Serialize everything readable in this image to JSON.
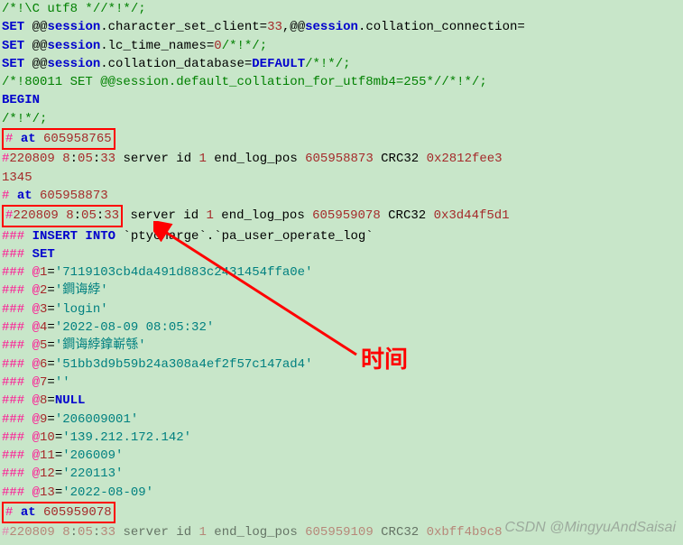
{
  "lines": {
    "l1": "/*!\\C utf8 *//*!*/;",
    "l2a": "SET",
    "l2b": " @@",
    "l2c": "session",
    "l2d": ".character_set_client=",
    "l2e": "33",
    "l2f": ",@@",
    "l2g": "session",
    "l2h": ".collation_connection=",
    "l3a": "SET",
    "l3b": " @@",
    "l3c": "session",
    "l3d": ".lc_time_names=",
    "l3e": "0",
    "l3f": "/*!*/;",
    "l4a": "SET",
    "l4b": " @@",
    "l4c": "session",
    "l4d": ".collation_database=",
    "l4e": "DEFAULT",
    "l4f": "/*!*/;",
    "l5a": "/*!80011 SET @@",
    "l5b": "session",
    "l5c": ".default_collation_for_utf8mb4=",
    "l5d": "255",
    "l5e": "*//*!*/;",
    "l6": "BEGIN",
    "l7": "/*!*/;",
    "l8a": "# ",
    "l8b": "at",
    "l8c": " 605958765",
    "l9a": "#",
    "l9b": "220809",
    "l9c": "   ",
    "l9d": "8",
    "l9e": ":",
    "l9f": "05",
    "l9g": ":",
    "l9h": "33",
    "l9i": " server id ",
    "l9j": "1",
    "l9k": "  end_log_pos ",
    "l9l": "605958873",
    "l9m": " CRC32 ",
    "l9n": "0x2812fee3",
    "l9o": "1345",
    "l10a": "# ",
    "l10b": "at",
    "l10c": " 605958873",
    "l11a": "#",
    "l11b": "220809",
    "l11c": "   ",
    "l11d": "8",
    "l11e": ":",
    "l11f": "05",
    "l11g": ":",
    "l11h": "33",
    "l11i": " server id ",
    "l11j": "1",
    "l11k": "  end_log_pos ",
    "l11l": "605959078",
    "l11m": " CRC32 ",
    "l11n": "0x3d44f5d1",
    "l12a": "### ",
    "l12b": "INSERT INTO",
    "l12c": " `ptycharge`.`pa_user_operate_log`",
    "l13a": "### ",
    "l13b": "SET",
    "l14a": "###   @",
    "l14b": "1",
    "l14c": "=",
    "l14d": "'7119103cb4da491d883c2431454ffa0e'",
    "l15a": "###   @",
    "l15b": "2",
    "l15c": "=",
    "l15d": "'鐧诲綍'",
    "l16a": "###   @",
    "l16b": "3",
    "l16c": "=",
    "l16d": "'login'",
    "l17a": "###   @",
    "l17b": "4",
    "l17c": "=",
    "l17d": "'2022-08-09 08:05:32'",
    "l18a": "###   @",
    "l18b": "5",
    "l18c": "=",
    "l18d": "'鐧诲綍鎿嶄綔'",
    "l19a": "###   @",
    "l19b": "6",
    "l19c": "=",
    "l19d": "'51bb3d9b59b24a308a4ef2f57c147ad4'",
    "l20a": "###   @",
    "l20b": "7",
    "l20c": "=",
    "l20d": "''",
    "l21a": "###   @",
    "l21b": "8",
    "l21c": "=",
    "l21d": "NULL",
    "l22a": "###   @",
    "l22b": "9",
    "l22c": "=",
    "l22d": "'206009001'",
    "l23a": "###   @",
    "l23b": "10",
    "l23c": "=",
    "l23d": "'139.212.172.142'",
    "l24a": "###   @",
    "l24b": "11",
    "l24c": "=",
    "l24d": "'206009'",
    "l25a": "###   @",
    "l25b": "12",
    "l25c": "=",
    "l25d": "'220113'",
    "l26a": "###   @",
    "l26b": "13",
    "l26c": "=",
    "l26d": "'2022-08-09'",
    "l27a": "# ",
    "l27b": "at",
    "l27c": " 605959078",
    "l28a": "#",
    "l28b": "220809",
    "l28c": "   ",
    "l28d": "8",
    "l28e": ":",
    "l28f": "05",
    "l28g": ":",
    "l28h": "33",
    "l28i": " server id ",
    "l28j": "1",
    "l28k": "  end_log_pos ",
    "l28l": "605959109",
    "l28m": " CRC32 ",
    "l28n": "0xbff4b9c8"
  },
  "annotation": "时间",
  "watermark": "CSDN @MingyuAndSaisai"
}
